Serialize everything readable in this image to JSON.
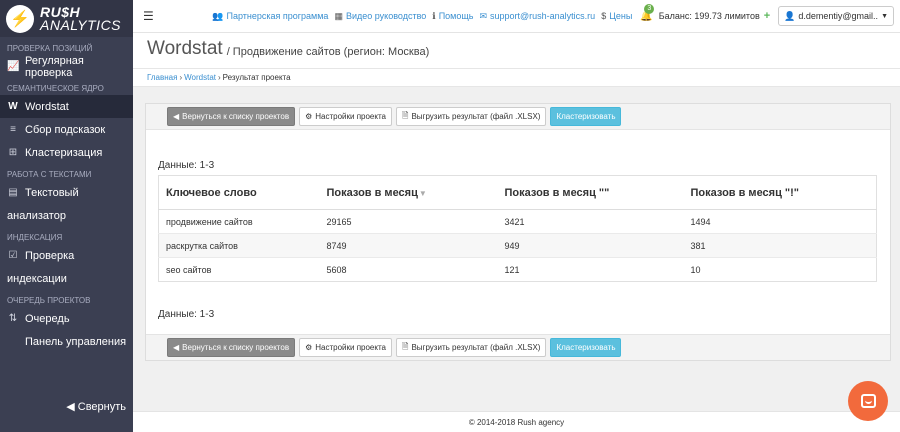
{
  "sidebar": {
    "logo_line1": "RU$H",
    "logo_line2": "ANALYTICS",
    "sections": {
      "positions": "ПРОВЕРКА ПОЗИЦИЙ",
      "semantic": "СЕМАНТИЧЕСКОЕ ЯДРО",
      "texts": "РАБОТА С ТЕКСТАМИ",
      "indexation": "ИНДЕКСАЦИЯ",
      "queue": "ОЧЕРЕДЬ ПРОЕКТОВ"
    },
    "items": {
      "regular_check": "Регулярная проверка",
      "wordstat": "Wordstat",
      "hints": "Сбор подсказок",
      "clustering": "Кластеризация",
      "text_analyzer_1": "Текстовый",
      "text_analyzer_2": "анализатор",
      "index_check_1": "Проверка",
      "index_check_2": "индексации",
      "queue": "Очередь",
      "control_panel": "Панель управления"
    },
    "collapse": "Свернуть"
  },
  "topbar": {
    "partner": "Партнерская программа",
    "video": "Видео руководство",
    "help": "Помощь",
    "support": "support@rush-analytics.ru",
    "prices": "Цены",
    "notifications": "3",
    "balance": "Баланс: 199.73 лимитов",
    "user": "d.dementiy@gmail.."
  },
  "header": {
    "title": "Wordstat",
    "subtitle": "/ Продвижение сайтов (регион: Москва)"
  },
  "breadcrumb": {
    "home": "Главная",
    "wordstat": "Wordstat",
    "current": "Результат проекта"
  },
  "toolbar": {
    "back": "Вернуться к списку проектов",
    "settings": "Настройки проекта",
    "export": "Выгрузить результат (файл .XLSX)",
    "cluster": "Кластеризовать"
  },
  "table": {
    "data_label": "Данные: 1-3",
    "columns": [
      "Ключевое слово",
      "Показов в месяц",
      "Показов в месяц \"\"",
      "Показов в месяц \"!\""
    ],
    "rows": [
      [
        "продвижение сайтов",
        "29165",
        "3421",
        "1494"
      ],
      [
        "раскрутка сайтов",
        "8749",
        "949",
        "381"
      ],
      [
        "seo сайтов",
        "5608",
        "121",
        "10"
      ]
    ]
  },
  "footer": "© 2014-2018 Rush agency",
  "colors": {
    "sidebar_bg": "#3b3f52",
    "accent_blue": "#3a8fd0",
    "cluster_btn": "#5bc0de",
    "chat_orange": "#f26a3c"
  }
}
